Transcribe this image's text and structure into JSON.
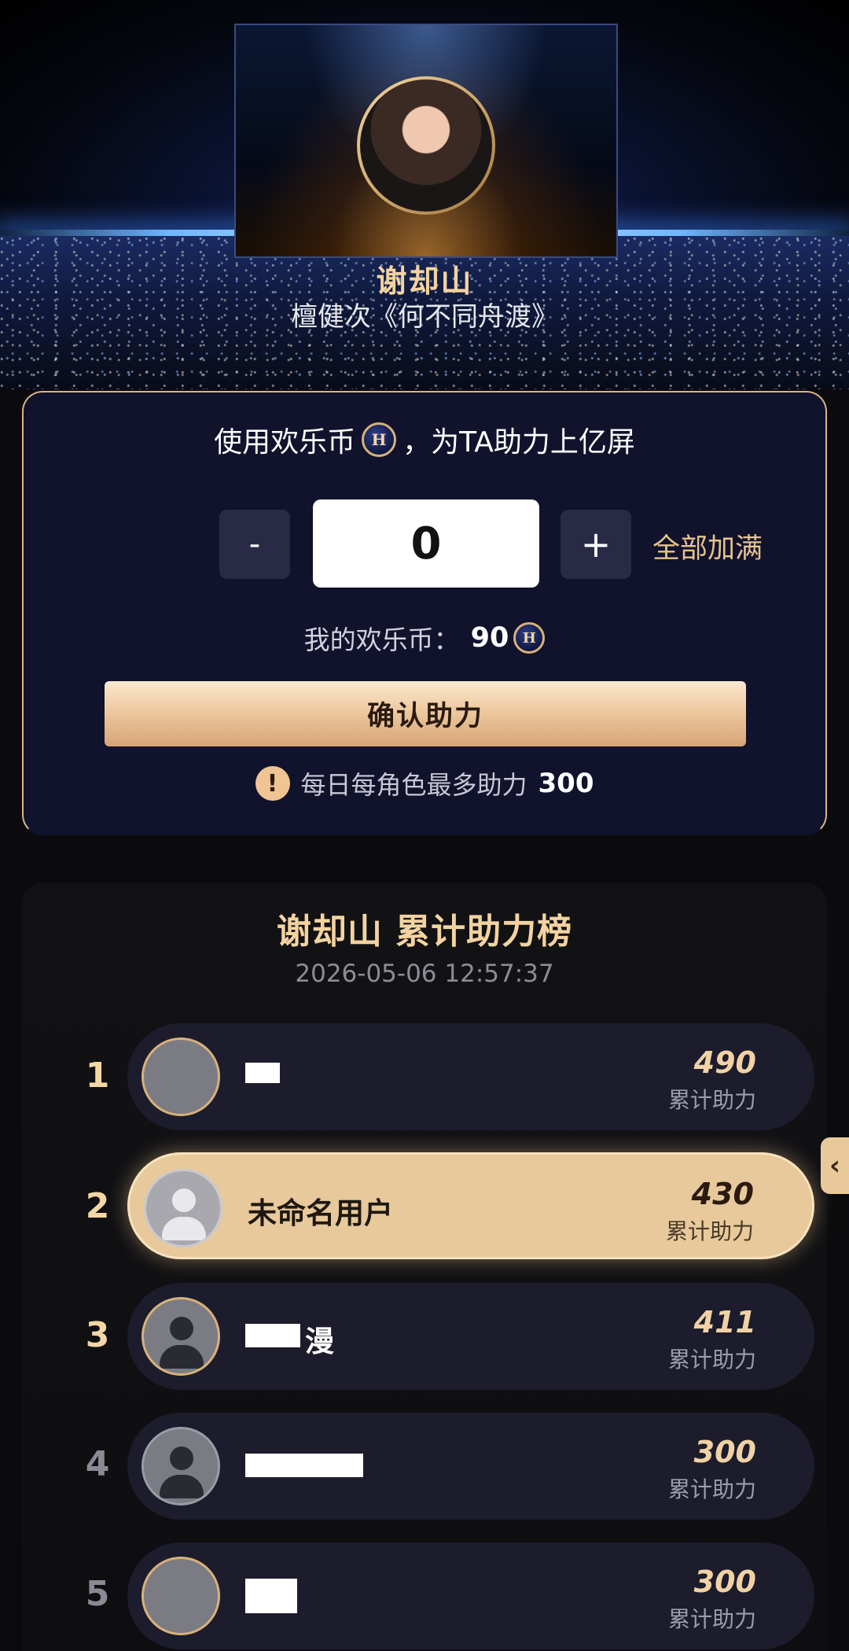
{
  "hero": {
    "character_name": "谢却山",
    "subtitle": "檀健次《何不同舟渡》"
  },
  "boost": {
    "prompt_before": "使用欢乐币",
    "prompt_after": "，为TA助力上亿屏",
    "coin_symbol": "H",
    "minus_label": "-",
    "quantity": "0",
    "plus_label": "+",
    "fill_all_label": "全部加满",
    "balance_label": "我的欢乐币：",
    "balance_value": "90",
    "confirm_label": "确认助力",
    "limit_icon": "!",
    "limit_text": "每日每角色最多助力",
    "limit_value": "300"
  },
  "leaderboard": {
    "title": "谢却山 累计助力榜",
    "timestamp": "2026-05-06 12:57:37",
    "score_label": "累计助力",
    "rows": [
      {
        "rank": "1",
        "name": "",
        "score": "490"
      },
      {
        "rank": "2",
        "name": "未命名用户",
        "score": "430"
      },
      {
        "rank": "3",
        "name": "漫",
        "score": "411"
      },
      {
        "rank": "4",
        "name": "",
        "score": "300"
      },
      {
        "rank": "5",
        "name": "",
        "score": "300"
      }
    ]
  },
  "side_tab": {
    "icon": "chevron-left-icon",
    "glyph": "‹"
  },
  "colors": {
    "accent_gold": "#f4d3a0",
    "card_bg": "#11122c",
    "highlight_row": "#e7c99b"
  }
}
